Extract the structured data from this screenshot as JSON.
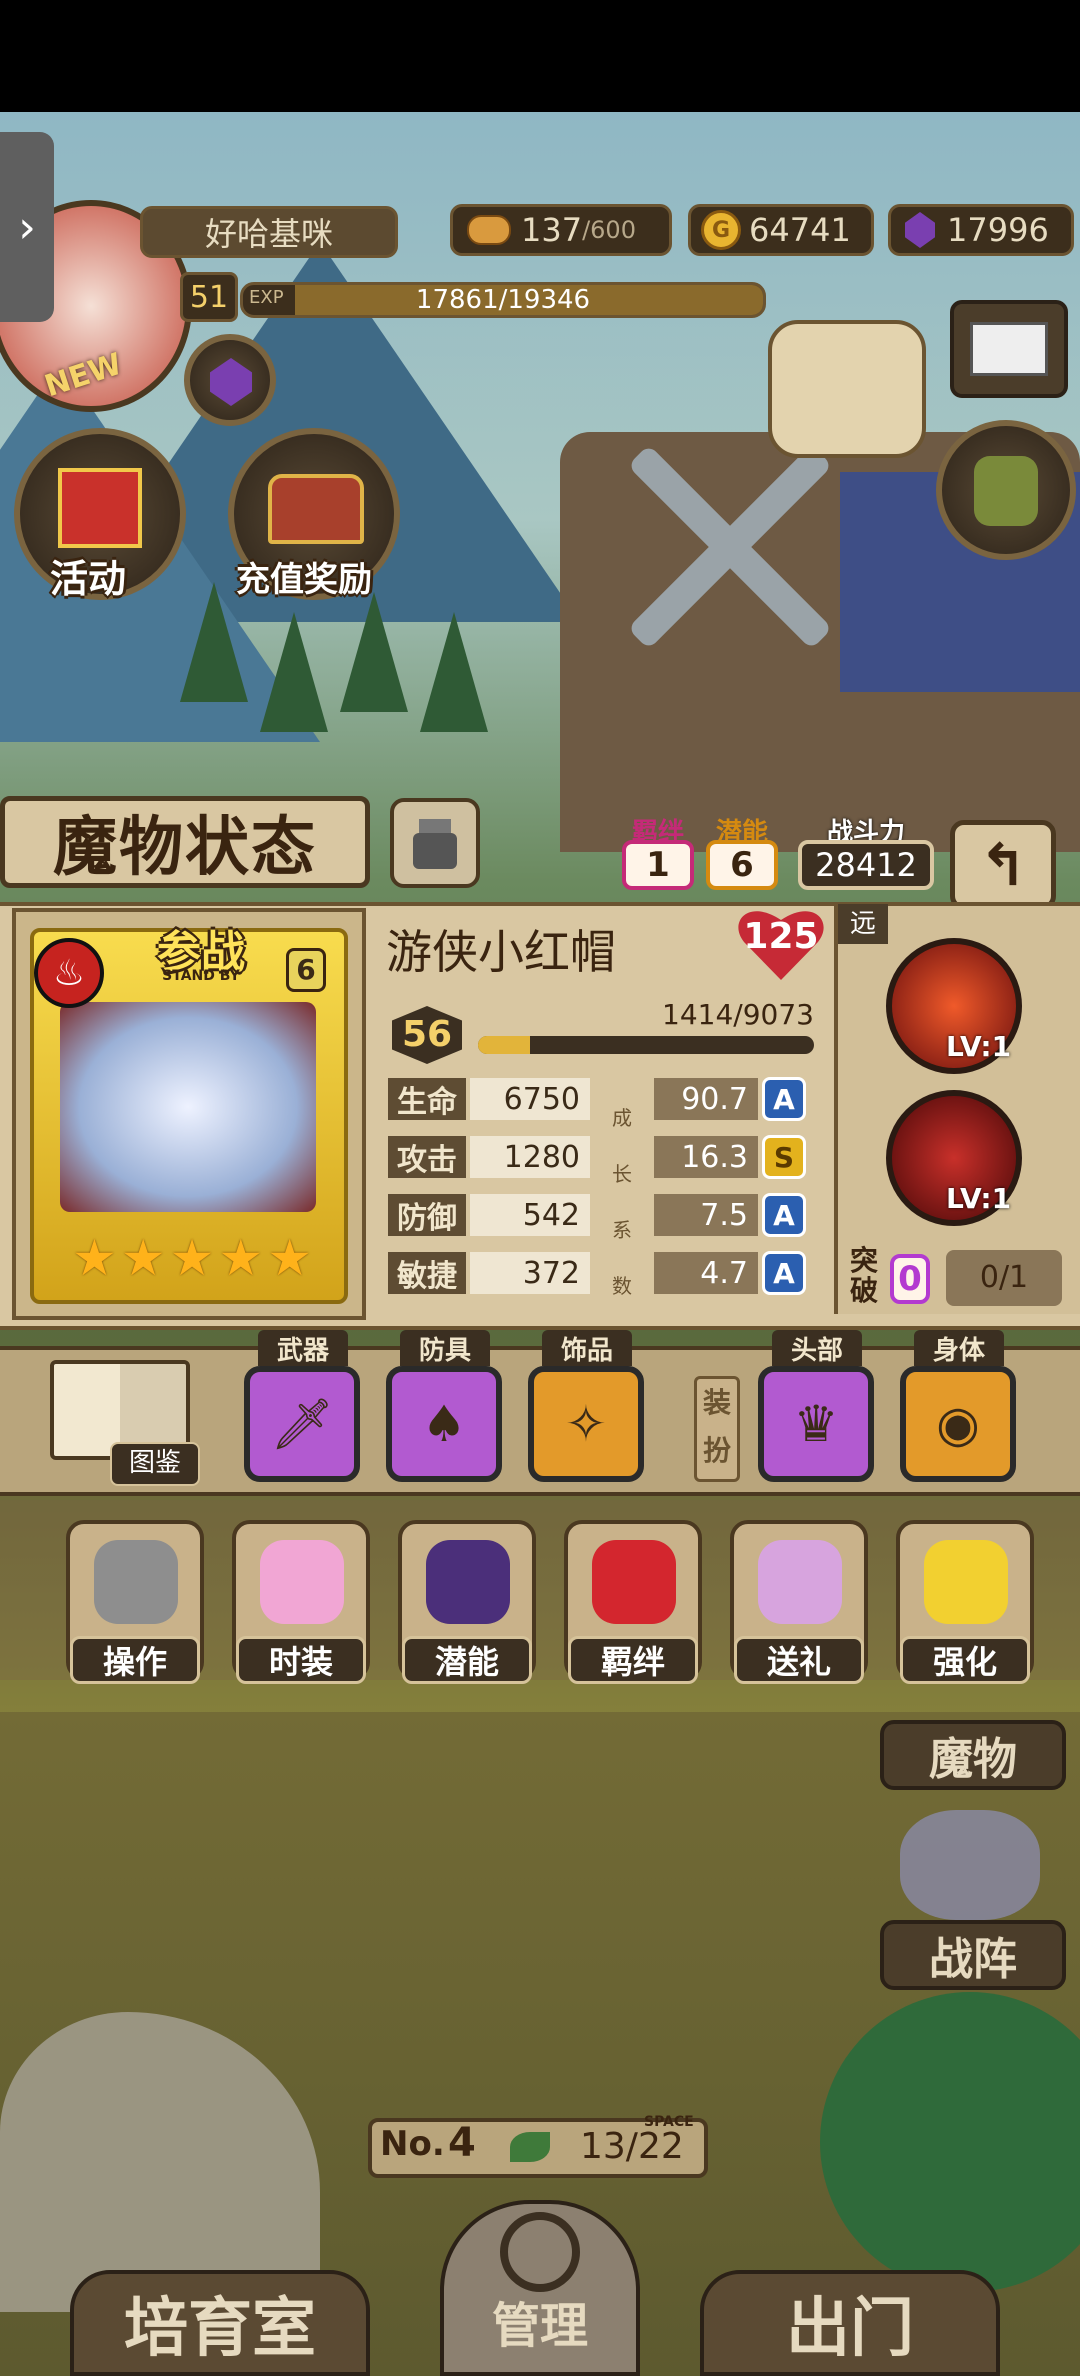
{
  "player": {
    "name": "好哈基咪",
    "level": "51",
    "exp_label": "EXP",
    "exp": "17861/19346",
    "exp_progress": 0.923,
    "new_badge": "NEW"
  },
  "resources": {
    "stamina_current": "137",
    "stamina_max": "/600",
    "gold": "64741",
    "gold_icon": "G",
    "gems": "17996"
  },
  "side_menu": {
    "activity": "活动",
    "recharge_reward": "充值奖励"
  },
  "monster_status": {
    "title": "魔物状态",
    "bond_label": "羁绊",
    "bond_value": "1",
    "potential_label": "潜能",
    "potential_value": "6",
    "power_label": "战斗力",
    "power_value": "28412"
  },
  "character": {
    "standby_label": "参战",
    "standby_sub": "STAND BY",
    "rank_badge": "6",
    "stars": 5,
    "name": "游侠小红帽",
    "heart_value": "125",
    "level": "56",
    "exp": "1414/9073",
    "exp_progress": 0.156,
    "range_tag": "远",
    "growth_label": [
      "成",
      "长",
      "系",
      "数"
    ],
    "stats": [
      {
        "label": "生命",
        "value": "6750",
        "growth": "90.7",
        "grade": "A"
      },
      {
        "label": "攻击",
        "value": "1280",
        "growth": "16.3",
        "grade": "S"
      },
      {
        "label": "防御",
        "value": "542",
        "growth": "7.5",
        "grade": "A"
      },
      {
        "label": "敏捷",
        "value": "372",
        "growth": "4.7",
        "grade": "A"
      }
    ],
    "skills": [
      {
        "level": "LV:1"
      },
      {
        "level": "LV:1"
      }
    ],
    "breakthrough_label": "突破",
    "breakthrough_count": "0",
    "breakthrough_progress": "0/1"
  },
  "equipment": {
    "guide_label": "图鉴",
    "dress_label": "装扮",
    "slots": [
      {
        "tag": "武器"
      },
      {
        "tag": "防具"
      },
      {
        "tag": "饰品"
      },
      {
        "tag": "头部"
      },
      {
        "tag": "身体"
      }
    ]
  },
  "menu": {
    "items": [
      "操作",
      "时装",
      "潜能",
      "羁绊",
      "送礼",
      "强化"
    ]
  },
  "right_buttons": {
    "monsters": "魔物",
    "formation": "战阵"
  },
  "footer": {
    "room_no_label": "No.",
    "room_no": "4",
    "space_label": "SPACE",
    "space_value": "13/22",
    "nursery": "培育室",
    "manage": "管理",
    "exit": "出门"
  }
}
